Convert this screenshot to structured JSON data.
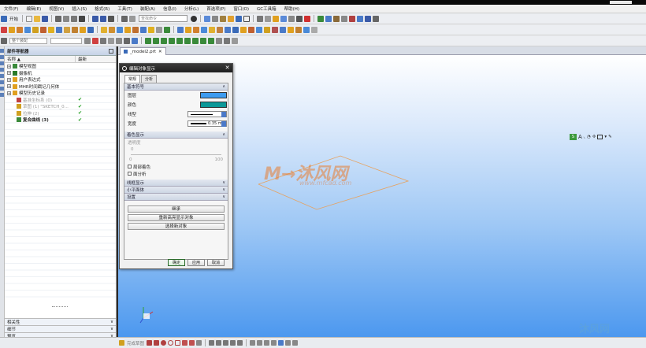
{
  "menu": [
    "文件(F)",
    "编辑(E)",
    "视图(V)",
    "插入(S)",
    "格式(R)",
    "工具(T)",
    "装配(A)",
    "信息(I)",
    "分析(L)",
    "首选项(P)",
    "窗口(O)",
    "GC工具箱",
    "帮助(H)"
  ],
  "toolbar": {
    "start_label": "开始",
    "search_placeholder": "查找命令",
    "filter_combo": "整个装配",
    "snap_combo": ""
  },
  "navigator": {
    "title": "部件导航器",
    "col_name": "名称 ▲",
    "col_latest": "最新",
    "rows": [
      {
        "label": "模型视图",
        "indent": 1,
        "color": "#3a8a3a",
        "check": "",
        "dim": false
      },
      {
        "label": "摄像机",
        "indent": 1,
        "color": "#2a7a2a",
        "check": "",
        "dim": false
      },
      {
        "label": "用户表达式",
        "indent": 1,
        "color": "#e0a020",
        "check": "",
        "dim": false
      },
      {
        "label": "MHR时间戳记几何体",
        "indent": 1,
        "color": "#e0a020",
        "check": "",
        "dim": false
      },
      {
        "label": "模型历史记录",
        "indent": 1,
        "color": "#e0a020",
        "check": "",
        "dim": false
      },
      {
        "label": "基准坐标系 (0)",
        "indent": 2,
        "color": "#c04040",
        "check": "✔",
        "dim": true
      },
      {
        "label": "草图 (1) \"SKETCH_0...",
        "indent": 2,
        "color": "#d0a020",
        "check": "✔",
        "dim": true
      },
      {
        "label": "拉伸 (2)",
        "indent": 2,
        "color": "#d0a020",
        "check": "✔",
        "dim": true
      },
      {
        "label": "复合曲线 (3)",
        "indent": 2,
        "color": "#3a8a3a",
        "check": "✔",
        "dim": false
      }
    ],
    "footer": [
      "相关性",
      "细节",
      "预览"
    ]
  },
  "view_tab": "_model2.prt",
  "dialog": {
    "title": "编辑对象显示",
    "tabs": [
      "常规",
      "分析"
    ],
    "section_basic": "基本符号",
    "layer_label": "图层",
    "color_label": "颜色",
    "linetype_label": "线型",
    "width_label": "宽度",
    "width_value": "0.35 mm",
    "layer_swatch": "#3d9bef",
    "color_swatch": "#0b9898",
    "section_shading": "着色显示",
    "transparency_label": "透明度",
    "slider_min": "0",
    "slider_max": "100",
    "slider_value": "0",
    "local_shading": "局部着色",
    "face_analysis": "面分析",
    "section_wireframe": "线框显示",
    "section_widgets": "小平面体",
    "section_settings": "设置",
    "btn_inherit": "继承",
    "btn_reselect": "重新高亮显示对象",
    "btn_select_new": "选择新对象",
    "btn_ok": "确定",
    "btn_apply": "应用",
    "btn_cancel": "取消"
  },
  "watermark": {
    "main": "M→沐风网",
    "sub": "www.mfcad.com",
    "corner": "沐风网"
  },
  "floatbar_label": "S",
  "status_label": "完成草图"
}
